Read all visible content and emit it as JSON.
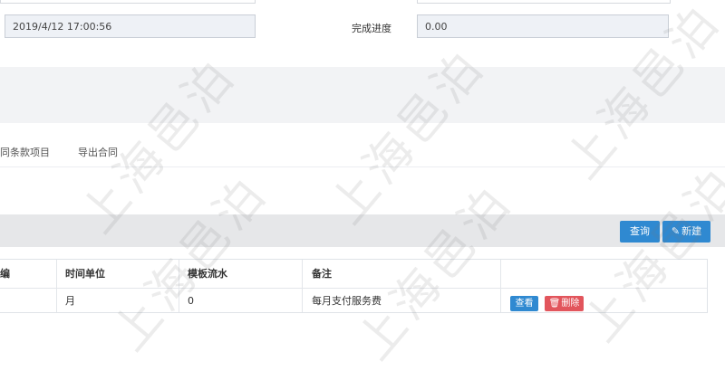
{
  "form": {
    "date_value": "2019/4/12 17:00:56",
    "progress_label": "完成进度",
    "progress_value": "0.00"
  },
  "tabs": [
    {
      "label": "同条款项目"
    },
    {
      "label": "导出合同"
    }
  ],
  "toolbar": {
    "query_label": "查询",
    "new_label": "新建"
  },
  "table": {
    "headers": [
      "编",
      "时间单位",
      "模板流水",
      "备注"
    ],
    "rows": [
      {
        "unit": "月",
        "template_serial": "0",
        "remark": "每月支付服务费"
      }
    ],
    "row_actions": {
      "view_label": "查看",
      "delete_label": "删除"
    }
  },
  "watermark": "上海邑泊",
  "colors": {
    "primary_button": "#2f89d1",
    "danger_button": "#e2555c"
  }
}
